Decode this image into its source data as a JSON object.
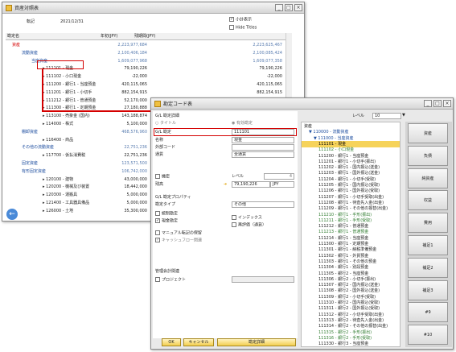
{
  "win1": {
    "title": "資産対照表",
    "date_label": "転記",
    "date_value": "2021/12/31",
    "subtotal_label": "小計表示",
    "hide_titles_label": "Hide Titles",
    "col_account": "勘定名",
    "col_ytd": "年初(JPY)",
    "col_period": "残期間(JPY)",
    "rows": [
      {
        "name": "資産",
        "v1": "2,223,977,684",
        "v2": "2,223,625,467",
        "cls": "red"
      },
      {
        "name": "流動資産",
        "v1": "2,100,406,184",
        "v2": "2,100,085,424",
        "cls": "blue"
      },
      {
        "name": "当座資産",
        "v1": "1,609,077,968",
        "v2": "1,609,077,358",
        "cls": "blue"
      },
      {
        "name": "111101 - 現金",
        "v1": "79,190,226",
        "v2": "79,190,226",
        "cls": "dark"
      },
      {
        "name": "111102 - 小口現金",
        "v1": "-22,000",
        "v2": "-22,000",
        "cls": "dark"
      },
      {
        "name": "111200 - 銀行1 - 当座預金",
        "v1": "420,115,065",
        "v2": "420,115,065",
        "cls": "dark"
      },
      {
        "name": "111201 - 銀行1 - 小切手",
        "v1": "882,154,915",
        "v2": "882,154,915",
        "cls": "dark"
      },
      {
        "name": "111212 - 銀行1 - 普通預金",
        "v1": "52,170,000",
        "v2": "52,170,000",
        "cls": "dark"
      },
      {
        "name": "111300 - 銀行1 - 定期預金",
        "v1": "27,180,888",
        "v2": "27,180,888",
        "cls": "dark"
      },
      {
        "name": "113100 - 売掛金 (国内)",
        "v1": "143,188,874",
        "v2": "143,188,874",
        "cls": "dark"
      },
      {
        "name": "114000 - 株式",
        "v1": "5,100,000",
        "v2": "5,100,000",
        "cls": "dark"
      },
      {
        "name": "棚卸資産",
        "v1": "468,576,960",
        "v2": "",
        "cls": "blue"
      },
      {
        "name": "116400 - 商品",
        "v1": "",
        "v2": "",
        "cls": "dark"
      },
      {
        "name": "その他の流動資産",
        "v1": "22,751,236",
        "v2": "",
        "cls": "blue"
      },
      {
        "name": "117700 - 仮払消費税",
        "v1": "22,751,236",
        "v2": "",
        "cls": "dark"
      },
      {
        "name": "固定資産",
        "v1": "123,571,500",
        "v2": "",
        "cls": "blue"
      },
      {
        "name": "有形固定資産",
        "v1": "106,742,000",
        "v2": "",
        "cls": "blue"
      },
      {
        "name": "120100 - 建物",
        "v1": "43,000,000",
        "v2": "",
        "cls": "dark"
      },
      {
        "name": "120200 - 機械及び装置",
        "v1": "18,442,000",
        "v2": "",
        "cls": "dark"
      },
      {
        "name": "120300 - 運搬具",
        "v1": "5,000,000",
        "v2": "",
        "cls": "dark"
      },
      {
        "name": "121400 - 工具器具備品",
        "v1": "5,000,000",
        "v2": "",
        "cls": "dark"
      },
      {
        "name": "126000 - 土地",
        "v1": "35,300,000",
        "v2": "",
        "cls": "dark"
      }
    ]
  },
  "win2": {
    "title": "勘定コード表",
    "gl_details": "G/L 勘定詳細",
    "radio_title": "タイトル",
    "radio_active": "有効勘定",
    "gl_account_label": "G/L 勘定",
    "gl_account_value": "111101",
    "name_label": "名称",
    "name_value": "現金",
    "ext_code_label": "外部コード",
    "currency_label": "通貨",
    "currency_value": "全通貨",
    "confidential_label": "機密",
    "level_label": "レベル",
    "level_value": "4",
    "balance_label": "残高",
    "balance_value": "79,190,226",
    "balance_currency": "JPY",
    "props_title": "G/L 勘定プロパティ",
    "account_type_label": "勘定タイプ",
    "account_type_value": "その他",
    "control_acct_label": "統制勘定",
    "cash_acct_label": "現金勘定",
    "indexed_label": "インデックス",
    "revaluation_label": "再評価（通貨）",
    "manual_block_label": "マニュアル転記の保留",
    "cashflow_label": "キャッシュフロー関連",
    "mgmt_title": "管理会計関連",
    "project_label": "プロジェクト",
    "level_top_label": "レベル",
    "level_top_value": "10",
    "ok_label": "OK",
    "cancel_label": "キャンセル",
    "detail_label": "勘定詳細",
    "tree": [
      {
        "t": "資産",
        "d": 0,
        "c": "dark"
      },
      {
        "t": "▼ 110000 - 流動資産",
        "d": 1,
        "c": "blue"
      },
      {
        "t": "▼ 111000 - 当座資産",
        "d": 2,
        "c": "blue"
      },
      {
        "t": "111101 - 現金",
        "d": 3,
        "c": "sel"
      },
      {
        "t": "111102 - 小口現金",
        "d": 3,
        "c": "green"
      },
      {
        "t": "111200 - 銀行1 - 当座預金",
        "d": 3,
        "c": "dark"
      },
      {
        "t": "111201 - 銀行1 - 小切手(振出)",
        "d": 3,
        "c": "dark"
      },
      {
        "t": "111202 - 銀行1 - 国内振込(送金)",
        "d": 3,
        "c": "dark"
      },
      {
        "t": "111203 - 銀行1 - 国外振込(送金)",
        "d": 3,
        "c": "dark"
      },
      {
        "t": "111204 - 銀行1 - 小切手(受取)",
        "d": 3,
        "c": "dark"
      },
      {
        "t": "111205 - 銀行1 - 国内振込(受取)",
        "d": 3,
        "c": "dark"
      },
      {
        "t": "111206 - 銀行1 - 国外振込(受取)",
        "d": 3,
        "c": "dark"
      },
      {
        "t": "111207 - 銀行1 - 小切手受取(出金)",
        "d": 3,
        "c": "dark"
      },
      {
        "t": "111208 - 銀行1 - 待査先入金(出金)",
        "d": 3,
        "c": "dark"
      },
      {
        "t": "111209 - 銀行1 - その他の振替(出金)",
        "d": 3,
        "c": "dark"
      },
      {
        "t": "111210 - 銀行1 - 手形(振出)",
        "d": 3,
        "c": "green"
      },
      {
        "t": "111211 - 銀行1 - 手形(受取)",
        "d": 3,
        "c": "green"
      },
      {
        "t": "111212 - 銀行1 - 普通預金",
        "d": 3,
        "c": "dark"
      },
      {
        "t": "111213 - 銀行1 - 普通預金",
        "d": 3,
        "c": "green"
      },
      {
        "t": "111214 - 銀行1 - 当座預金",
        "d": 3,
        "c": "dark"
      },
      {
        "t": "111300 - 銀行1 - 定期預金",
        "d": 3,
        "c": "dark"
      },
      {
        "t": "111301 - 銀行1 - 納税準備預金",
        "d": 3,
        "c": "dark"
      },
      {
        "t": "111302 - 銀行1 - 外貨預金",
        "d": 3,
        "c": "dark"
      },
      {
        "t": "111303 - 銀行1 - その他の預金",
        "d": 3,
        "c": "dark"
      },
      {
        "t": "111304 - 銀行1 - 別段預金",
        "d": 3,
        "c": "dark"
      },
      {
        "t": "111305 - 銀行2 - 当座預金",
        "d": 3,
        "c": "dark"
      },
      {
        "t": "111306 - 銀行2 - 小切手(振出)",
        "d": 3,
        "c": "dark"
      },
      {
        "t": "111307 - 銀行2 - 国内振込(送金)",
        "d": 3,
        "c": "dark"
      },
      {
        "t": "111308 - 銀行2 - 国外振込(送金)",
        "d": 3,
        "c": "dark"
      },
      {
        "t": "111309 - 銀行2 - 小切手(受取)",
        "d": 3,
        "c": "dark"
      },
      {
        "t": "111310 - 銀行2 - 国内振込(受取)",
        "d": 3,
        "c": "dark"
      },
      {
        "t": "111311 - 銀行2 - 国外振込(受取)",
        "d": 3,
        "c": "dark"
      },
      {
        "t": "111312 - 銀行2 - 小切手受取(出金)",
        "d": 3,
        "c": "dark"
      },
      {
        "t": "111313 - 銀行2 - 待査先入金(出金)",
        "d": 3,
        "c": "dark"
      },
      {
        "t": "111314 - 銀行2 - その他の振替(出金)",
        "d": 3,
        "c": "dark"
      },
      {
        "t": "111315 - 銀行2 - 手形(振出)",
        "d": 3,
        "c": "green"
      },
      {
        "t": "111316 - 銀行2 - 手形(受取)",
        "d": 3,
        "c": "green"
      },
      {
        "t": "111330 - 銀行3 - 当座預金",
        "d": 3,
        "c": "dark"
      }
    ],
    "side_buttons": [
      "資産",
      "負債",
      "純資産",
      "収益",
      "費用",
      "補足1",
      "補足2",
      "補足3",
      "#9",
      "#10"
    ]
  },
  "colors": {
    "accent_red": "#d40000",
    "selection": "#f6d35a"
  }
}
